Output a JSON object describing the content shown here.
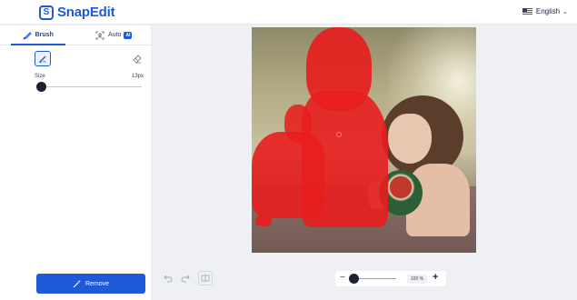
{
  "app": {
    "name": "SnapEdit"
  },
  "header": {
    "language": "English"
  },
  "sidebar": {
    "tabs": [
      {
        "label": "Brush",
        "active": true
      },
      {
        "label": "Auto",
        "badge": "AI"
      }
    ],
    "size_label": "Size",
    "size_value": "13px",
    "remove_label": "Remove"
  },
  "canvas": {
    "zoom_value": "100 %",
    "zoom_minus": "−",
    "zoom_plus": "+"
  },
  "colors": {
    "accent": "#1e5ad8",
    "mask": "#e71e1e",
    "background": "#eef0f4"
  },
  "icons": [
    "snapedit-logo-icon",
    "us-flag-icon",
    "chevron-down-icon",
    "brush-icon",
    "auto-select-icon",
    "eraser-icon",
    "magic-wand-icon",
    "undo-icon",
    "redo-icon",
    "compare-icon"
  ]
}
